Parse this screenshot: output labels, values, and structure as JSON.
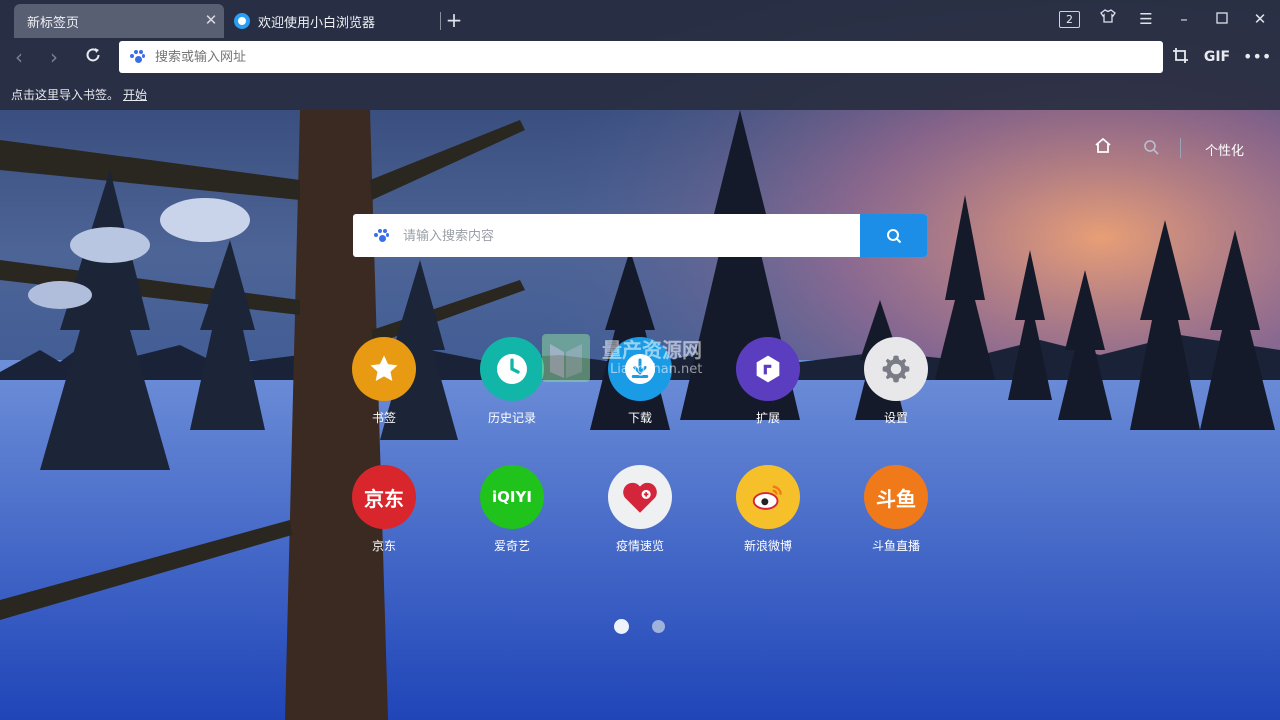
{
  "tabs": [
    {
      "label": "新标签页",
      "active": true
    },
    {
      "label": "欢迎使用小白浏览器",
      "active": false
    }
  ],
  "window": {
    "tab_count": "2"
  },
  "address_bar": {
    "value": "",
    "placeholder": "搜索或输入网址"
  },
  "toolbar": {
    "gif_label": "GIF"
  },
  "bookmark_bar": {
    "hint": "点击这里导入书签。",
    "start_link": "开始"
  },
  "newtab": {
    "personalize_label": "个性化",
    "search_placeholder": "请输入搜索内容",
    "shortcuts": [
      {
        "label": "书签",
        "icon": "star-icon",
        "color": "#e89a12"
      },
      {
        "label": "历史记录",
        "icon": "clock-icon",
        "color": "#12b6a8"
      },
      {
        "label": "下载",
        "icon": "download-icon",
        "color": "#1a9be6"
      },
      {
        "label": "扩展",
        "icon": "extension-icon",
        "color": "#5b3ec0"
      },
      {
        "label": "设置",
        "icon": "gear-icon",
        "color": "#e8e8ea"
      },
      {
        "label": "京东",
        "icon": "jd-logo",
        "color": "#d9262c",
        "logo_text": "京东"
      },
      {
        "label": "爱奇艺",
        "icon": "iqiyi-logo",
        "color": "#20c21c",
        "logo_text": "iQIYI"
      },
      {
        "label": "疫情速览",
        "icon": "heart-icon",
        "color": "#eef0f2"
      },
      {
        "label": "新浪微博",
        "icon": "weibo-logo",
        "color": "#f5c02a"
      },
      {
        "label": "斗鱼直播",
        "icon": "douyu-logo",
        "color": "#f07a1a",
        "logo_text": "斗鱼"
      }
    ],
    "pagination": {
      "current": 1,
      "total": 2
    }
  },
  "watermark": {
    "title": "量产资源网",
    "url": "Liangchan.net"
  }
}
